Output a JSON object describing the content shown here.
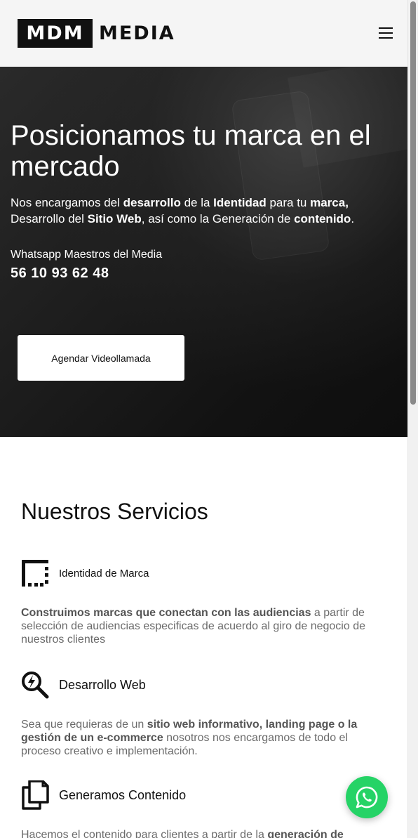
{
  "header": {
    "logo_box_text": "MDM",
    "logo_text": "MEDIA",
    "menu_icon": "hamburger-icon"
  },
  "hero": {
    "title": "Posicionamos tu marca en el mercado",
    "desc": {
      "p1": "Nos encargamos del ",
      "b1": "desarrollo",
      "p2": " de la ",
      "b2": "Identidad",
      "p3": " para tu ",
      "b3": "marca,",
      "p4": " Desarrollo del ",
      "b4": "Sitio Web",
      "p5": ", así como la Generación de ",
      "b5": "contenido",
      "p6": "."
    },
    "whatsapp_label": "Whatsapp Maestros del Media",
    "whatsapp_number": "56 10 93 62 48",
    "cta_label": "Agendar Videollamada"
  },
  "services": {
    "title": "Nuestros Servicios",
    "items": [
      {
        "icon": "border-style-icon",
        "name": "Identidad de Marca",
        "desc_bold": "Construimos marcas que conectan con las audiencias",
        "desc_rest": " a partir de selección de audiencias especificas de acuerdo al giro de negocio de nuestros clientes"
      },
      {
        "icon": "search-bolt-icon",
        "name": "Desarrollo Web",
        "desc_p1": "Sea que requieras de un ",
        "desc_bold": "sitio web informativo, landing page o la gestión de un e-commerce",
        "desc_rest": " nosotros nos encargamos de todo el proceso creativo e implementación."
      },
      {
        "icon": "copy-files-icon",
        "name": "Generamos Contenido",
        "desc_p1": "Hacemos el contenido para clientes a partir de la ",
        "desc_bold": "generación de"
      }
    ]
  },
  "fab": {
    "icon": "whatsapp-icon",
    "color": "#25d366"
  }
}
